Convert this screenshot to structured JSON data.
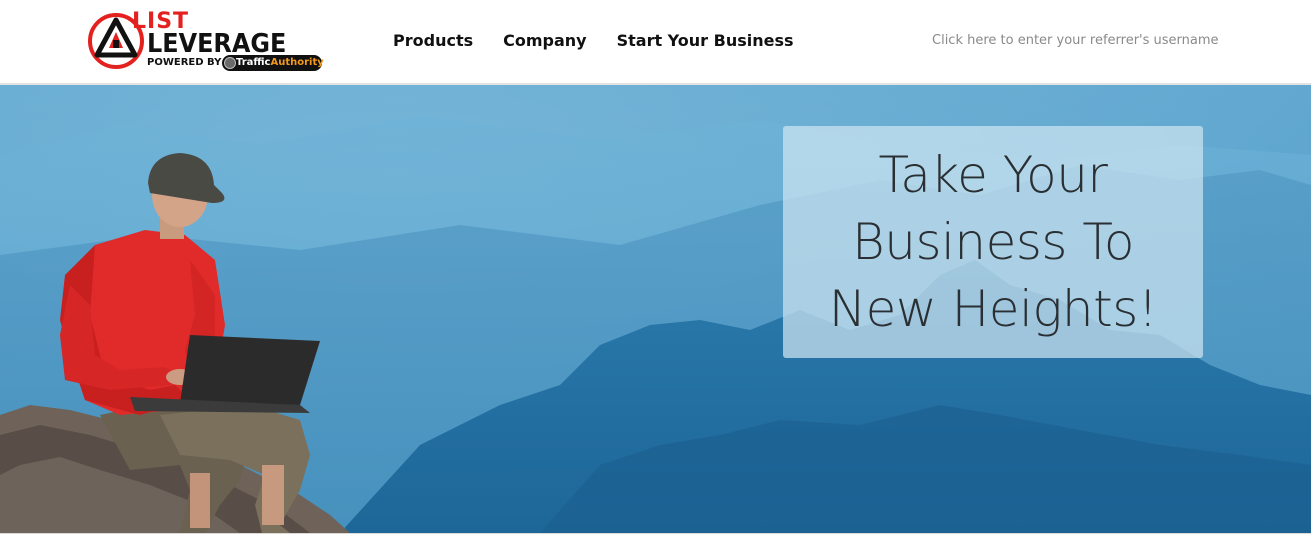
{
  "brand": {
    "logo_line1": "LIST",
    "logo_line2": "LEVERAGE",
    "powered_by": "POWERED BY",
    "partner_prefix": "Traffic",
    "partner_suffix": "Authority",
    "accent_color": "#e3221f",
    "partner_accent_color": "#f39a1e",
    "logo_icon": "triangle-in-circle-icon"
  },
  "nav": {
    "items": [
      {
        "label": "Products"
      },
      {
        "label": "Company"
      },
      {
        "label": "Start Your Business"
      }
    ]
  },
  "referrer": {
    "label": "Click here to enter your referrer's username"
  },
  "hero": {
    "headline_lines": [
      "Take Your",
      "Business To",
      "New Heights!"
    ],
    "sky_color": "#58a6d0",
    "mountain_color": "#1f6fa3"
  }
}
